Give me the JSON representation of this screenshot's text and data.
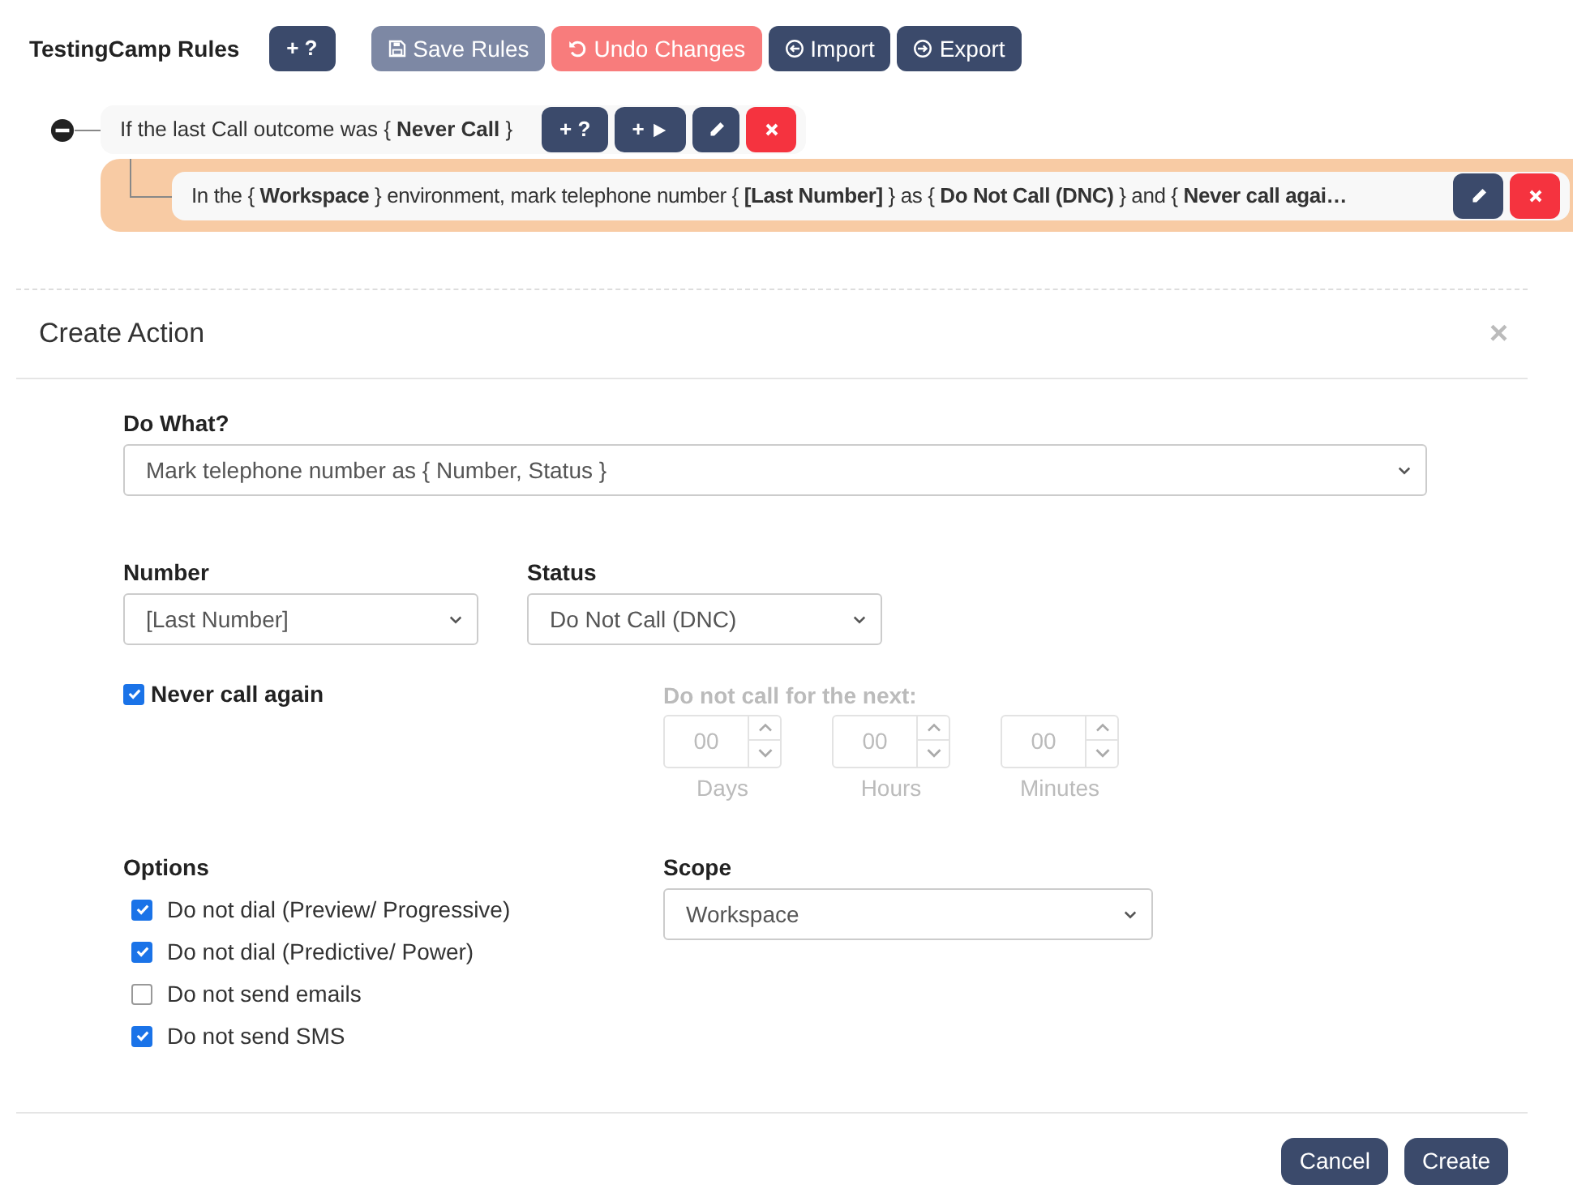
{
  "header": {
    "title": "TestingCamp Rules",
    "buttons": [
      {
        "kind": "add",
        "label": "+ ?"
      },
      {
        "kind": "save",
        "label": "Save Rules",
        "disabled": true
      },
      {
        "kind": "undo",
        "label": "Undo Changes"
      },
      {
        "kind": "import",
        "label": "Import"
      },
      {
        "kind": "export",
        "label": "Export"
      }
    ]
  },
  "rule": {
    "expanded": true,
    "text": "If the last Call outcome was { **Never Call** }",
    "buttons": [
      {
        "kind": "add",
        "label": "+ ?"
      },
      {
        "kind": "add-action",
        "label": "+"
      },
      {
        "kind": "edit"
      },
      {
        "kind": "delete"
      }
    ],
    "actions": [
      {
        "text": "In the { **Workspace** } environment, mark telephone number { **[Last Number]** } as { **Do Not Call (DNC)** } and { **Never call agai…**",
        "buttons": [
          {
            "kind": "edit"
          },
          {
            "kind": "delete"
          }
        ]
      }
    ]
  },
  "dialog": {
    "title": "Create Action",
    "close": "×",
    "do_what": {
      "label": "Do What?",
      "value": "Mark telephone number as { Number, Status }"
    },
    "number": {
      "label": "Number",
      "value": "[Last Number]"
    },
    "status": {
      "label": "Status",
      "value": "Do Not Call (DNC)"
    },
    "never_call_again": {
      "label": "Never call again",
      "checked": true
    },
    "do_not_call_for": {
      "label": "Do not call for the next:",
      "disabled": true,
      "fields": [
        {
          "value": "00",
          "unit": "Days"
        },
        {
          "value": "00",
          "unit": "Hours"
        },
        {
          "value": "00",
          "unit": "Minutes"
        }
      ]
    },
    "options": {
      "label": "Options",
      "items": [
        {
          "label": "Do not dial (Preview/ Progressive)",
          "checked": true
        },
        {
          "label": "Do not dial (Predictive/ Power)",
          "checked": true
        },
        {
          "label": "Do not send emails",
          "checked": false
        },
        {
          "label": "Do not send SMS",
          "checked": true
        }
      ]
    },
    "scope": {
      "label": "Scope",
      "value": "Workspace"
    },
    "buttons": [
      {
        "label": "Cancel"
      },
      {
        "label": "Create"
      }
    ]
  }
}
